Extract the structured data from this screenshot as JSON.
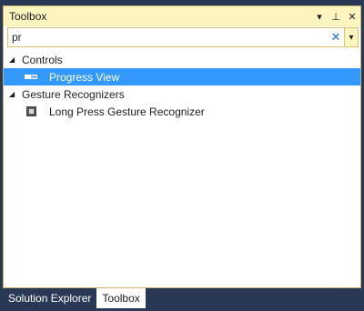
{
  "window": {
    "title": "Toolbox",
    "dropdown_glyph": "▾",
    "pin_glyph": "⊥",
    "close_glyph": "✕"
  },
  "search": {
    "value": "pr",
    "clear_glyph": "✕",
    "dropdown_glyph": "▾"
  },
  "groups": [
    {
      "label": "Controls",
      "expanded_glyph": "◢",
      "items": [
        {
          "label": "Progress View",
          "icon": "progress-view-icon",
          "selected": true
        }
      ]
    },
    {
      "label": "Gesture Recognizers",
      "expanded_glyph": "◢",
      "items": [
        {
          "label": "Long Press Gesture Recognizer",
          "icon": "long-press-gesture-icon",
          "selected": false
        }
      ]
    }
  ],
  "tabs": [
    {
      "label": "Solution Explorer",
      "active": false
    },
    {
      "label": "Toolbox",
      "active": true
    }
  ],
  "colors": {
    "frame": "#293955",
    "titlebar": "#fdf4bf",
    "selection": "#3399ff",
    "accent": "#1e6fd9"
  }
}
